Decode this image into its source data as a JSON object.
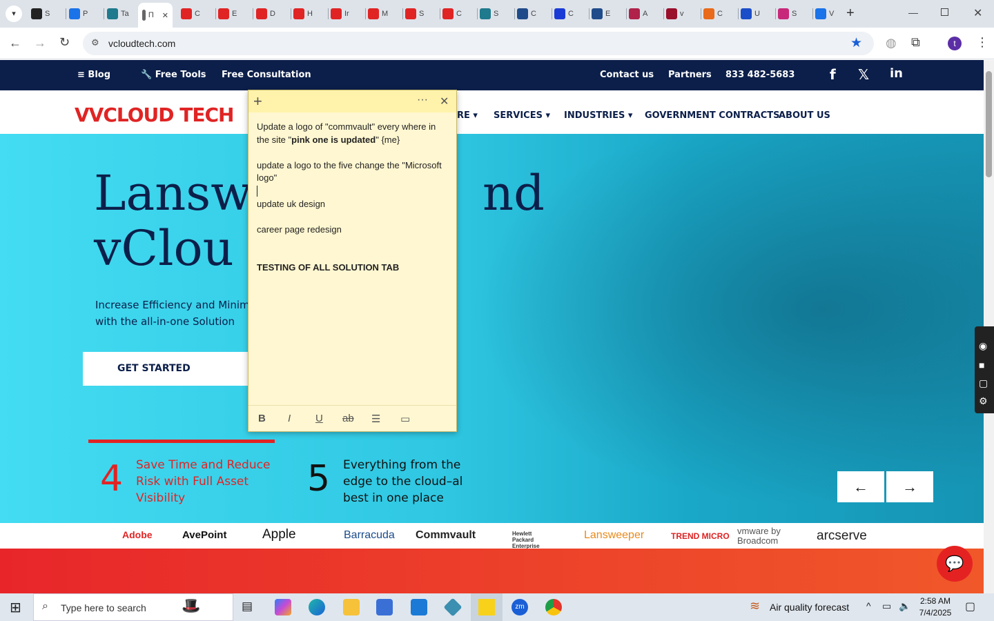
{
  "browser": {
    "tabs": [
      {
        "label": "S",
        "color": "#222"
      },
      {
        "label": "P",
        "color": "#1a73e8"
      },
      {
        "label": "Ta",
        "color": "#1e7a8c"
      },
      {
        "label": "Π",
        "color": "#666"
      },
      {
        "label": "C",
        "color": "#e02424"
      },
      {
        "label": "E",
        "color": "#e02424"
      },
      {
        "label": "D",
        "color": "#e02424"
      },
      {
        "label": "H",
        "color": "#e02424"
      },
      {
        "label": "Ir",
        "color": "#e02424"
      },
      {
        "label": "M",
        "color": "#e02424"
      },
      {
        "label": "S",
        "color": "#e02424"
      },
      {
        "label": "C",
        "color": "#e02424"
      },
      {
        "label": "S",
        "color": "#1e7a8c"
      },
      {
        "label": "C",
        "color": "#1f4b8a"
      },
      {
        "label": "C",
        "color": "#1a3ad6"
      },
      {
        "label": "E",
        "color": "#1f4b8a"
      },
      {
        "label": "A",
        "color": "#b0224a"
      },
      {
        "label": "v",
        "color": "#9a0f2a"
      },
      {
        "label": "C",
        "color": "#e86a1a"
      },
      {
        "label": "U",
        "color": "#1a4dc8"
      },
      {
        "label": "S",
        "color": "#c8287a"
      },
      {
        "label": "V",
        "color": "#1a73e8"
      }
    ],
    "url": "vcloudtech.com",
    "new_tab": "+",
    "profile_initial": "t"
  },
  "site": {
    "topbar": {
      "blog": "Blog",
      "free_tools": "Free Tools",
      "free_consultation": "Free Consultation",
      "contact": "Contact us",
      "partners": "Partners",
      "phone": "833 482-5683",
      "social": [
        "f",
        "𝕏",
        "in"
      ]
    },
    "logo_text": "VCLOUD TECH",
    "nav": [
      "RE",
      "SERVICES",
      "INDUSTRIES",
      "GOVERNMENT CONTRACTS",
      "ABOUT US"
    ],
    "hero": {
      "headline_line1": "Lansw",
      "headline_right1": "nd",
      "headline_line2": "vClou",
      "subtitle_line1": "Increase Efficiency and Minim",
      "subtitle_line2": "with the all-in-one Solution",
      "cta": "GET STARTED"
    },
    "stats": [
      {
        "number": "4",
        "text": "Save Time and Reduce Risk with Full Asset Visibility"
      },
      {
        "number": "5",
        "text": "Everything from the edge to the cloud–al best in one place"
      }
    ],
    "arrows": {
      "prev": "←",
      "next": "→"
    },
    "partner_logos": [
      "Adobe",
      "AvePoint",
      "Apple",
      "Barracuda",
      "Commvault",
      "Hewlett Packard Enterprise",
      "Lansweeper",
      "TREND MICRO",
      "vmware by Broadcom",
      "arcserve"
    ]
  },
  "sticky_note": {
    "lines": [
      "Update a logo of \"commvault\" every where in the site \"pink one is updated\" {me}",
      "update a logo to the five change the \"Microsoft logo\"",
      "update uk design",
      "career page redesign",
      "TESTING OF ALL SOLUTION TAB"
    ],
    "bold_phrase": "pink one is updated",
    "format_buttons": [
      "B",
      "I",
      "U",
      "ab",
      "list",
      "image"
    ]
  },
  "taskbar": {
    "search_placeholder": "Type here to search",
    "weather": "Air quality forecast",
    "time": "2:58 AM",
    "date": "7/4/2025"
  }
}
